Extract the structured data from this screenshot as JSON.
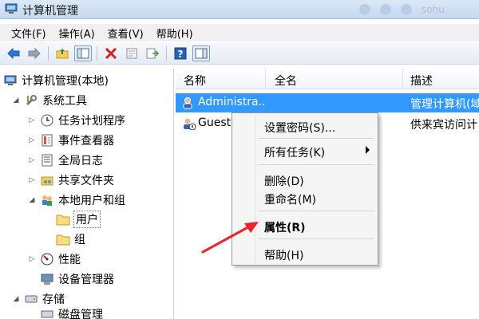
{
  "window": {
    "title": "计算机管理",
    "titlebar_fragment": "sohu"
  },
  "menu": [
    "文件(F)",
    "操作(A)",
    "查看(V)",
    "帮助(H)"
  ],
  "toolbar": {
    "icons": [
      "back-arrow-icon",
      "forward-arrow-icon",
      "up-folder-icon",
      "show-hide-tree-icon",
      "delete-icon",
      "properties-icon",
      "export-list-icon",
      "help-icon",
      "show-hide-action-pane-icon"
    ]
  },
  "tree": {
    "root": "计算机管理(本地)",
    "system_tools": "系统工具",
    "task_scheduler": "任务计划程序",
    "event_viewer": "事件查看器",
    "global_log": "全局日志",
    "shared_folders": "共享文件夹",
    "local_users_groups": "本地用户和组",
    "users": "用户",
    "groups": "组",
    "performance": "性能",
    "device_manager": "设备管理器",
    "storage": "存储",
    "disk_mgmt_partial": "磁盘管理"
  },
  "list": {
    "columns": [
      "名称",
      "全名",
      "描述"
    ],
    "rows": [
      {
        "name": "Administra...",
        "fullname": "",
        "description": "管理计算机(域"
      },
      {
        "name": "Guest",
        "fullname": "",
        "description": "供来宾访问计"
      }
    ]
  },
  "context_menu": {
    "set_password": "设置密码(S)...",
    "all_tasks": "所有任务(K)",
    "delete": "删除(D)",
    "rename": "重命名(M)",
    "properties": "属性(R)",
    "help": "帮助(H)"
  },
  "colors": {
    "selection": "#3399ff",
    "annotation_arrow": "#e8262a"
  }
}
